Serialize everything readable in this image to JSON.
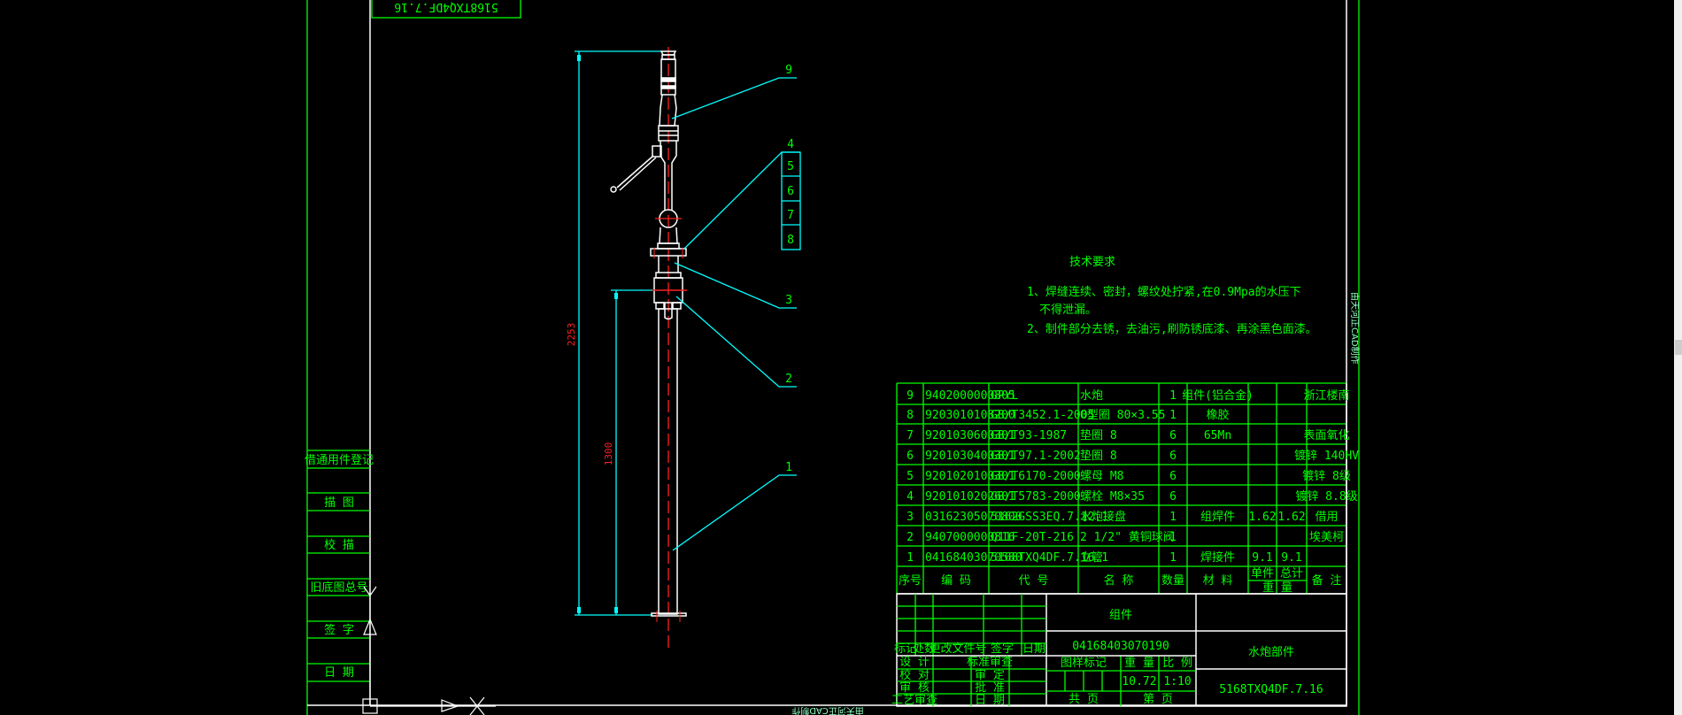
{
  "stamp_code": "5168TXQ4DF.7.16",
  "side_note": "由天河正CAD制作",
  "left_column": [
    "借通用件登记",
    "描 图",
    "校 描",
    "旧底图总号",
    "签 字",
    "日 期"
  ],
  "balloons": [
    "9",
    "4",
    "5",
    "6",
    "7",
    "8",
    "3",
    "2",
    "1"
  ],
  "dimensions": {
    "overall": "2253",
    "lower": "1300"
  },
  "tech_requirements": {
    "title": "技术要求",
    "lines": [
      "1、焊缝连续、密封，螺纹处拧紧,在0.9Mpa的水压下",
      "不得泄漏。",
      "2、制件部分去锈，去油污,刷防锈底漆、再涂黑色面漆。"
    ]
  },
  "bom": {
    "rows": [
      [
        "9",
        "9402000000805",
        "GPYL",
        "水炮",
        "1",
        "组件(铝合金)",
        "",
        "",
        "浙江楼南"
      ],
      [
        "8",
        "9203010108200",
        "GB/T3452.1-2005",
        "O型圈 80×3.55",
        "1",
        "橡胶",
        "",
        "",
        ""
      ],
      [
        "7",
        "9201030600301",
        "GB/T93-1987",
        "垫圈 8",
        "6",
        "65Mn",
        "",
        "",
        "表面氧化"
      ],
      [
        "6",
        "9201030400301",
        "GB/T97.1-2002",
        "垫圈 8",
        "6",
        "",
        "",
        "",
        "镀锌 140HV"
      ],
      [
        "5",
        "9201020100301",
        "GB/T6170-2000",
        "螺母 M8",
        "6",
        "",
        "",
        "",
        "镀锌 8级"
      ],
      [
        "4",
        "9201010202601",
        "GB/T5783-2000",
        "螺栓 M8×35",
        "6",
        "",
        "",
        "",
        "镀锌 8.8级"
      ],
      [
        "3",
        "03162305070800",
        "5162GSS3EQ.7.12.1",
        "水炮接盘",
        "1",
        "组焊件",
        "1.62",
        "1.62",
        "借用"
      ],
      [
        "2",
        "9407000000816",
        "Q11F-20T-216",
        "2 1/2\" 黄铜球阀",
        "1",
        "",
        "",
        "",
        "埃美柯"
      ],
      [
        "1",
        "04168403070580",
        "5168TXQ4DF.7.16.1",
        "立管",
        "1",
        "焊接件",
        "9.1",
        "9.1",
        ""
      ]
    ],
    "headers": [
      "序号",
      "编 码",
      "代 号",
      "名 称",
      "数量",
      "材 料",
      "单件",
      "总计",
      "备 注"
    ],
    "weight_header": "重 量"
  },
  "title_block": {
    "assembly_label": "组件",
    "code": "04168403070190",
    "name": "水炮部件",
    "drawing_no": "5168TXQ4DF.7.16",
    "rev_headers": [
      "标记",
      "处数",
      "更改文件号",
      "签字",
      "日期"
    ],
    "sign_rows": [
      [
        "设 计",
        "标准审查"
      ],
      [
        "校 对",
        "审 定"
      ],
      [
        "审 核",
        "批 准"
      ],
      [
        "工艺审查",
        "日 期"
      ]
    ],
    "stage_label": "图样标记",
    "weight_label": "重 量",
    "scale_label": "比 例",
    "weight": "10.72",
    "scale": "1:10",
    "total_pages": "共 页",
    "page_no": "第 页"
  }
}
